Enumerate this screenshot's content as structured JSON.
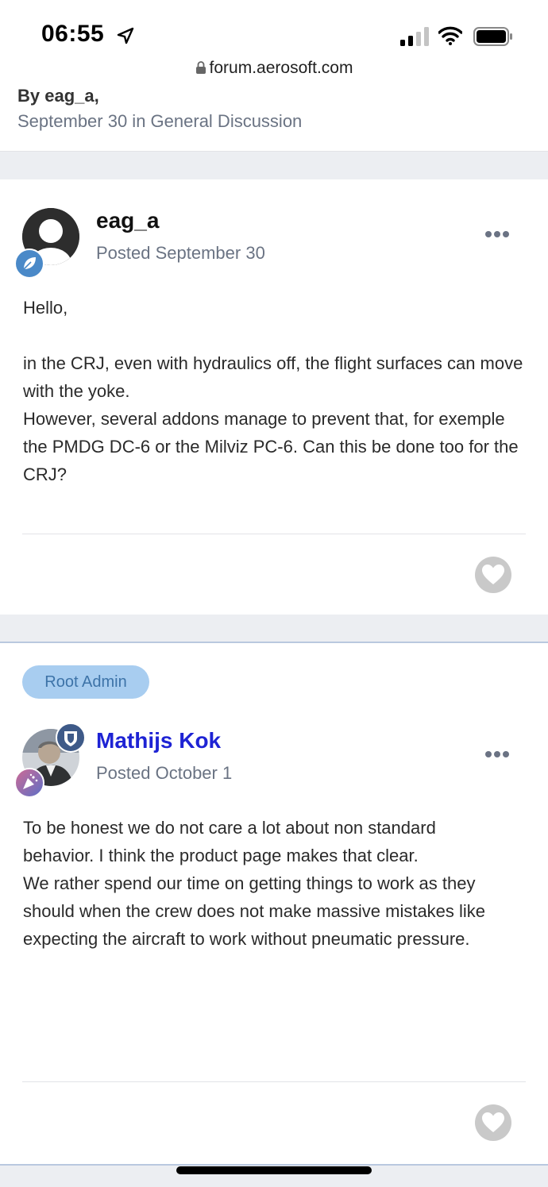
{
  "status_bar": {
    "time": "06:55",
    "url": "forum.aerosoft.com"
  },
  "topic_header": {
    "author_line": "By eag_a,",
    "date_line": "September 30 in General Discussion"
  },
  "posts": [
    {
      "username": "eag_a",
      "posted": "Posted September 30",
      "body": [
        "Hello,",
        "",
        "in the CRJ, even with hydraulics off, the flight surfaces can move with the yoke.",
        "However, several addons manage to prevent that, for exemple the PMDG DC-6 or the Milviz PC-6. Can this be done too for the CRJ?"
      ]
    },
    {
      "role_badge": "Root Admin",
      "username": "Mathijs Kok",
      "posted": "Posted October 1",
      "body": [
        "To be honest we do not care a lot about non standard behavior. I think the product page makes that clear.",
        "We rather spend our time on getting things to work as they should when the crew does not make massive mistakes like expecting the aircraft to work without pneumatic pressure."
      ]
    }
  ],
  "colors": {
    "admin_name": "#1e23d4",
    "badge_blue": "#4a89c8",
    "role_badge_bg": "#a8cdf0"
  },
  "icons": [
    "location-arrow-icon",
    "signal-icon",
    "wifi-icon",
    "battery-icon",
    "lock-icon",
    "more-icon",
    "like-heart-icon",
    "leaf-badge-icon",
    "shield-badge-icon",
    "party-badge-icon"
  ]
}
